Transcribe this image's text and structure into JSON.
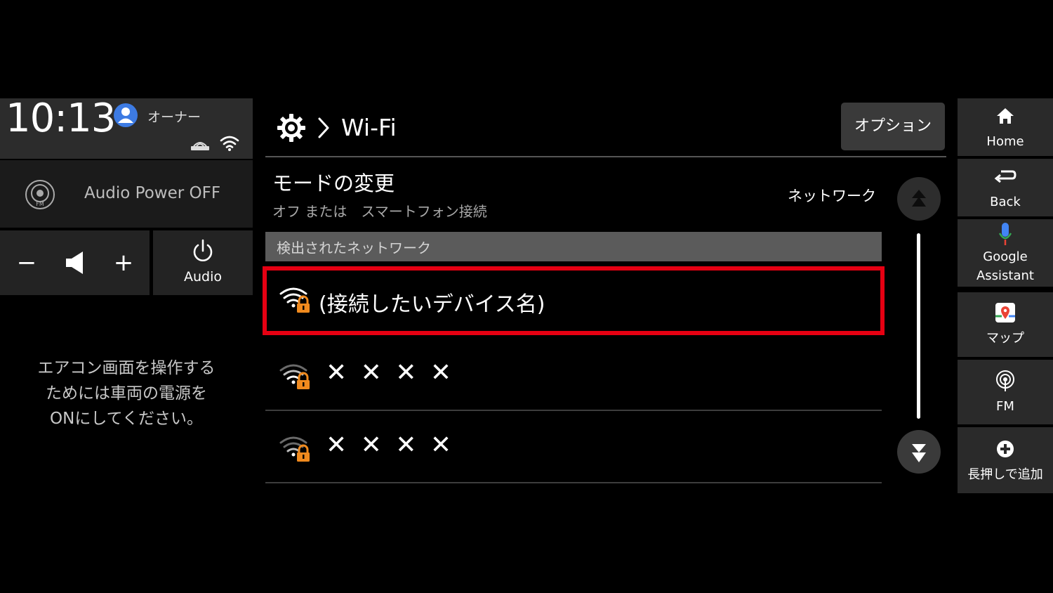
{
  "status": {
    "time": "10:13",
    "user": "オーナー"
  },
  "audio": {
    "power_label": "Audio Power OFF",
    "vol_minus": "−",
    "vol_plus": "+",
    "audio_button": "Audio"
  },
  "aircon_note": "エアコン画面を操作する\nためには車両の電源を\nONにしてください。",
  "header": {
    "title": "Wi-Fi",
    "options": "オプション"
  },
  "mode": {
    "title": "モードの変更",
    "subtitle": "オフ または　スマートフォン接続",
    "value": "ネットワーク"
  },
  "networks": {
    "section_label": "検出されたネットワーク",
    "items": [
      {
        "name": "(接続したいデバイス名)",
        "highlighted": true
      },
      {
        "name": "✕ ✕ ✕ ✕"
      },
      {
        "name": "✕ ✕ ✕ ✕"
      }
    ]
  },
  "dock": {
    "home": "Home",
    "back": "Back",
    "assistant": "Google\nAssistant",
    "map": "マップ",
    "fm": "FM",
    "add": "長押しで追加"
  },
  "colors": {
    "highlight": "#e60012",
    "lock": "#f08a1e",
    "user_icon": "#3d7be3"
  }
}
